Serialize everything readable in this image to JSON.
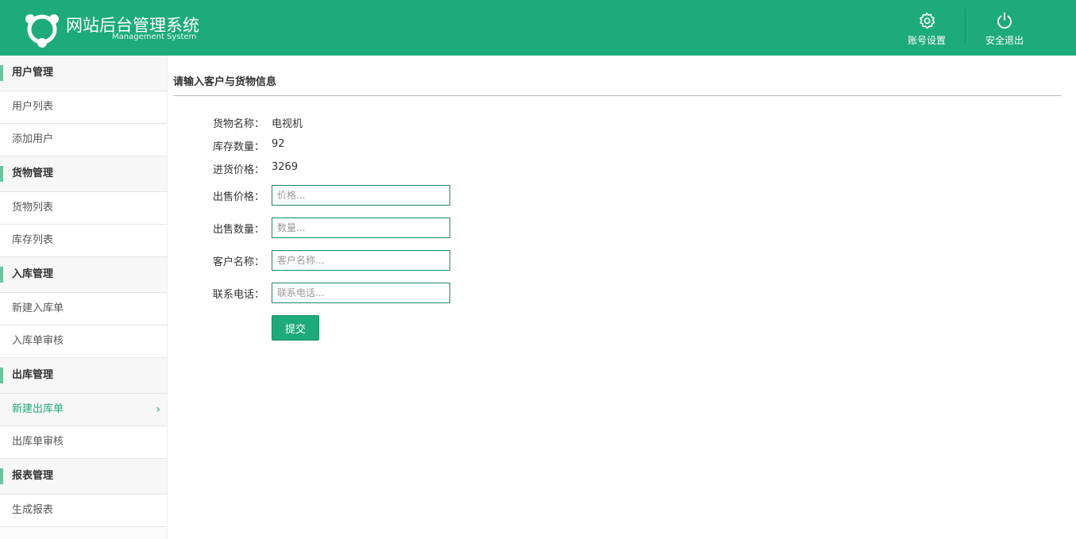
{
  "header": {
    "title": "网站后台管理系统",
    "subtitle": "Management System",
    "account_settings_label": "账号设置",
    "logout_label": "安全退出"
  },
  "sidebar": {
    "groups": [
      {
        "label": "用户管理",
        "items": [
          {
            "label": "用户列表"
          },
          {
            "label": "添加用户"
          }
        ]
      },
      {
        "label": "货物管理",
        "items": [
          {
            "label": "货物列表"
          },
          {
            "label": "库存列表"
          }
        ]
      },
      {
        "label": "入库管理",
        "items": [
          {
            "label": "新建入库单"
          },
          {
            "label": "入库单审核"
          }
        ]
      },
      {
        "label": "出库管理",
        "items": [
          {
            "label": "新建出库单",
            "active": true
          },
          {
            "label": "出库单审核"
          }
        ]
      },
      {
        "label": "报表管理",
        "items": [
          {
            "label": "生成报表"
          }
        ]
      }
    ]
  },
  "main": {
    "title": "请输入客户与货物信息",
    "info": {
      "goods_name_label": "货物名称：",
      "goods_name_value": "电视机",
      "stock_qty_label": "库存数量：",
      "stock_qty_value": "92",
      "purchase_price_label": "进货价格：",
      "purchase_price_value": "3269"
    },
    "form": {
      "sale_price_label": "出售价格：",
      "sale_price_placeholder": "价格...",
      "sale_qty_label": "出售数量：",
      "sale_qty_placeholder": "数量...",
      "customer_name_label": "客户名称：",
      "customer_name_placeholder": "客户名称...",
      "phone_label": "联系电话：",
      "phone_placeholder": "联系电话...",
      "submit_label": "提交"
    }
  },
  "colors": {
    "accent": "#1dab7b",
    "sidebar_marker": "#67c6a0"
  }
}
